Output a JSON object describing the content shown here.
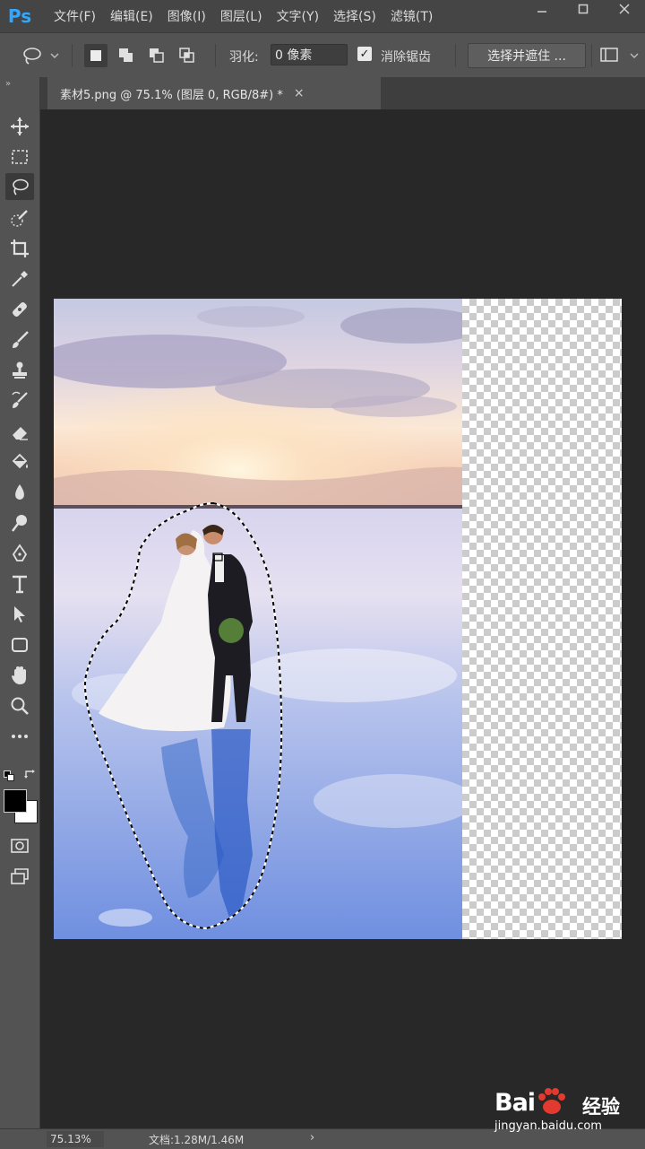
{
  "app": {
    "logo": "Ps"
  },
  "menu": [
    "文件(F)",
    "编辑(E)",
    "图像(I)",
    "图层(L)",
    "文字(Y)",
    "选择(S)",
    "滤镜(T)"
  ],
  "window_controls": [
    "minimize-icon",
    "restore-icon",
    "close-icon"
  ],
  "options": {
    "feather_label": "羽化:",
    "feather_value": "0 像素",
    "antialias_label": "消除锯齿",
    "antialias_checked": true,
    "refine_button": "选择并遮住 ..."
  },
  "toolbar": {
    "collapse": "»",
    "tools": [
      "move",
      "rectangular-marquee",
      "lasso",
      "quick-selection",
      "crop",
      "eyedropper",
      "healing-brush",
      "brush",
      "clone-stamp",
      "history-brush",
      "eraser",
      "paint-bucket",
      "blur",
      "dodge",
      "pen",
      "type",
      "path-selection",
      "rectangle",
      "hand",
      "zoom",
      "more"
    ],
    "active_tool": "lasso",
    "foreground_color": "#000000",
    "background_color": "#ffffff"
  },
  "document": {
    "tab_title": "素材5.png @ 75.1% (图层 0, RGB/8#) *",
    "close": "×"
  },
  "status": {
    "zoom": "75.13%",
    "doc_size": "文档:1.28M/1.46M",
    "arrow": "›"
  },
  "watermark": {
    "brand_prefix": "Bai",
    "brand_suffix": "经验",
    "url": "jingyan.baidu.com"
  }
}
